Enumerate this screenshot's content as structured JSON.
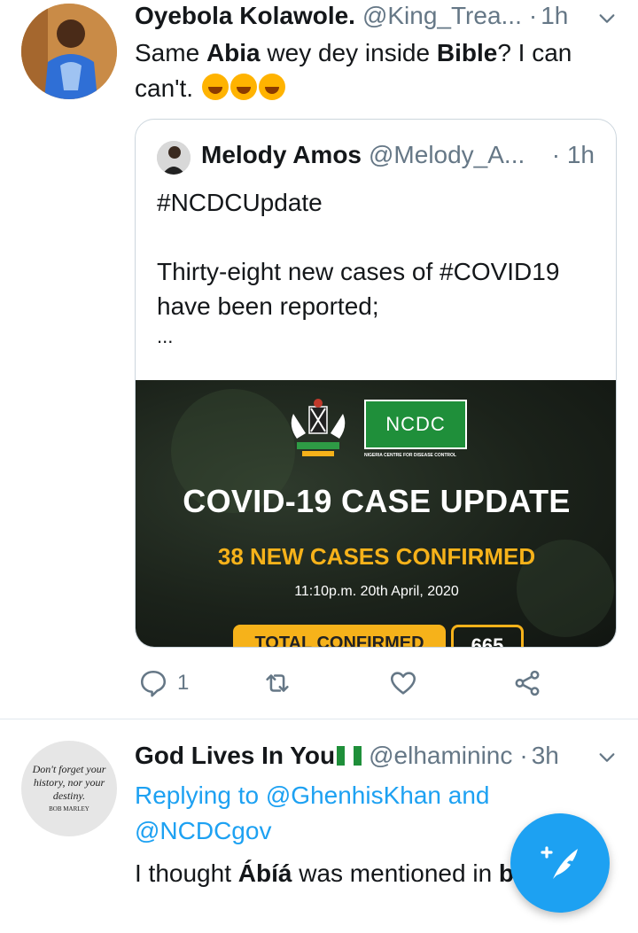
{
  "tweet1": {
    "name": "Oyebola Kolawole.",
    "handle": "@King_Trea...",
    "dot": "·",
    "time": "1h",
    "text_parts": {
      "p1": "Same ",
      "b1": "Abia",
      "p2": " wey dey inside ",
      "b2": "Bible",
      "p3": "? I can can't."
    },
    "emoji_name": "rolling-on-floor-laughing-emoji",
    "quoted": {
      "name": "Melody Amos",
      "handle": "@Melody_A...",
      "dot": "·",
      "time": "1h",
      "line1": "#NCDCUpdate",
      "line2": "Thirty-eight new cases of #COVID19 have been reported;",
      "line3": "...",
      "image": {
        "logo_text": "NCDC",
        "logo_sub": "NIGERIA CENTRE FOR DISEASE CONTROL",
        "headline": "COVID-19 CASE UPDATE",
        "subheadline": "38 NEW CASES CONFIRMED",
        "date": "11:10p.m. 20th April, 2020",
        "total_label": "TOTAL CONFIRMED",
        "total_value": "665"
      }
    },
    "actions": {
      "reply_count": "1",
      "retweet_count": "",
      "like_count": ""
    }
  },
  "tweet2": {
    "name": "God Lives In You",
    "handle": "@elhamininc",
    "dot": "·",
    "time": "3h",
    "replying_prefix": "Replying to ",
    "replying_users": "@GhenhisKhan and @NCDCgov",
    "text_p1": "I thought ",
    "text_b1": "Ábíá",
    "text_p2": " was mentioned in ",
    "text_b2": "bible",
    "avatar_quote": {
      "line1": "Don't forget your",
      "line2": "history, nor your",
      "line3": "destiny.",
      "author": "BOB MARLEY"
    }
  },
  "colors": {
    "accent": "#1da1f2",
    "secondary_text": "#657786",
    "border": "#ccd6dd",
    "ncdc_green": "#1f8f3a",
    "ncdc_gold": "#f6b21a"
  }
}
